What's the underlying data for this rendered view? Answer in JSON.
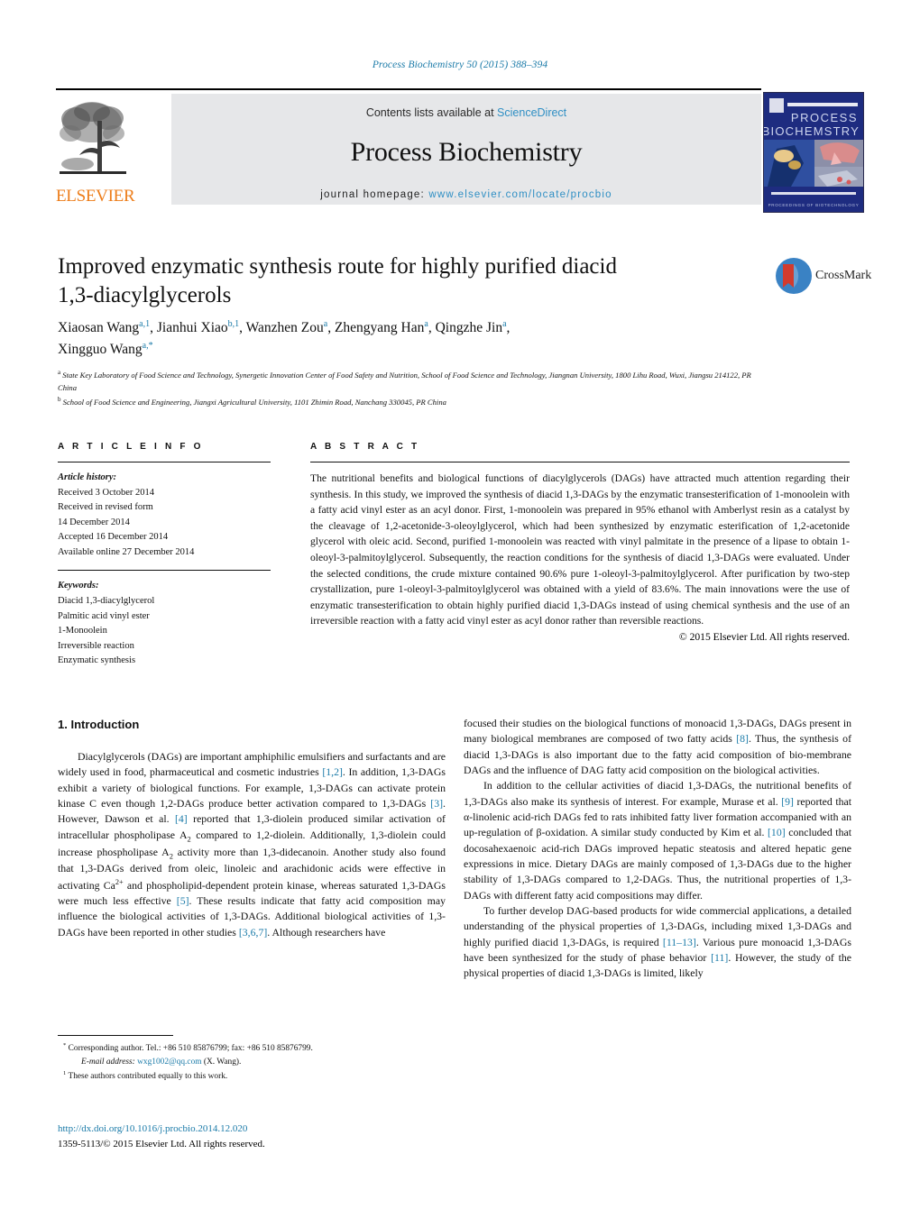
{
  "running_head": "Process Biochemistry 50 (2015) 388–394",
  "masthead": {
    "contents_text": "Contents lists available at",
    "sciencedirect": "ScienceDirect",
    "journal_name": "Process Biochemistry",
    "homepage_label": "journal homepage:",
    "homepage_url": "www.elsevier.com/locate/procbio",
    "publisher": "ELSEVIER",
    "cover_line1": "PROCESS",
    "cover_line2": "BIOCHEMISTRY",
    "accent_color": "#2f8fc4",
    "elsevier_orange": "#ed7d1a"
  },
  "crossmark": {
    "label": "CrossMark"
  },
  "article": {
    "title_line1": "Improved enzymatic synthesis route for highly purified diacid",
    "title_line2": "1,3-diacylglycerols",
    "authors": [
      {
        "name": "Xiaosan Wang",
        "marks": "a,1"
      },
      {
        "name": "Jianhui Xiao",
        "marks": "b,1"
      },
      {
        "name": "Wanzhen Zou",
        "marks": "a"
      },
      {
        "name": "Zhengyang Han",
        "marks": "a"
      },
      {
        "name": "Qingzhe Jin",
        "marks": "a"
      },
      {
        "name": "Xingguo Wang",
        "marks": "a,*"
      }
    ],
    "affiliations": [
      {
        "mark": "a",
        "text": "State Key Laboratory of Food Science and Technology, Synergetic Innovation Center of Food Safety and Nutrition, School of Food Science and Technology, Jiangnan University, 1800 Lihu Road, Wuxi, Jiangsu 214122, PR China"
      },
      {
        "mark": "b",
        "text": "School of Food Science and Engineering, Jiangxi Agricultural University, 1101 Zhimin Road, Nanchang 330045, PR China"
      }
    ]
  },
  "article_info": {
    "heading": "A R T I C L E   I N F O",
    "history_label": "Article history:",
    "history": [
      "Received 3 October 2014",
      "Received in revised form",
      "14 December 2014",
      "Accepted 16 December 2014",
      "Available online 27 December 2014"
    ],
    "keywords_label": "Keywords:",
    "keywords": [
      "Diacid 1,3-diacylglycerol",
      "Palmitic acid vinyl ester",
      "1-Monoolein",
      "Irreversible reaction",
      "Enzymatic synthesis"
    ]
  },
  "abstract": {
    "heading": "A B S T R A C T",
    "text": "The nutritional benefits and biological functions of diacylglycerols (DAGs) have attracted much attention regarding their synthesis. In this study, we improved the synthesis of diacid 1,3-DAGs by the enzymatic transesterification of 1-monoolein with a fatty acid vinyl ester as an acyl donor. First, 1-monoolein was prepared in 95% ethanol with Amberlyst resin as a catalyst by the cleavage of 1,2-acetonide-3-oleoylglycerol, which had been synthesized by enzymatic esterification of 1,2-acetonide glycerol with oleic acid. Second, purified 1-monoolein was reacted with vinyl palmitate in the presence of a lipase to obtain 1-oleoyl-3-palmitoylglycerol. Subsequently, the reaction conditions for the synthesis of diacid 1,3-DAGs were evaluated. Under the selected conditions, the crude mixture contained 90.6% pure 1-oleoyl-3-palmitoylglycerol. After purification by two-step crystallization, pure 1-oleoyl-3-palmitoylglycerol was obtained with a yield of 83.6%. The main innovations were the use of enzymatic transesterification to obtain highly purified diacid 1,3-DAGs instead of using chemical synthesis and the use of an irreversible reaction with a fatty acid vinyl ester as acyl donor rather than reversible reactions.",
    "copyright": "© 2015 Elsevier Ltd. All rights reserved."
  },
  "introduction": {
    "section_number": "1.",
    "section_title": "Introduction",
    "left_paragraph": "Diacylglycerols (DAGs) are important amphiphilic emulsifiers and surfactants and are widely used in food, pharmaceutical and cosmetic industries [1,2]. In addition, 1,3-DAGs exhibit a variety of biological functions. For example, 1,3-DAGs can activate protein kinase C even though 1,2-DAGs produce better activation compared to 1,3-DAGs [3]. However, Dawson et al. [4] reported that 1,3-diolein produced similar activation of intracellular phospholipase A2 compared to 1,2-diolein. Additionally, 1,3-diolein could increase phospholipase A2 activity more than 1,3-didecanoin. Another study also found that 1,3-DAGs derived from oleic, linoleic and arachidonic acids were effective in activating Ca2+ and phospholipid-dependent protein kinase, whereas saturated 1,3-DAGs were much less effective [5]. These results indicate that fatty acid composition may influence the biological activities of 1,3-DAGs. Additional biological activities of 1,3-DAGs have been reported in other studies [3,6,7]. Although researchers have",
    "right_paragraph_1": "focused their studies on the biological functions of monoacid 1,3-DAGs, DAGs present in many biological membranes are composed of two fatty acids [8]. Thus, the synthesis of diacid 1,3-DAGs is also important due to the fatty acid composition of bio-membrane DAGs and the influence of DAG fatty acid composition on the biological activities.",
    "right_paragraph_2": "In addition to the cellular activities of diacid 1,3-DAGs, the nutritional benefits of 1,3-DAGs also make its synthesis of interest. For example, Murase et al. [9] reported that α-linolenic acid-rich DAGs fed to rats inhibited fatty liver formation accompanied with an up-regulation of β-oxidation. A similar study conducted by Kim et al. [10] concluded that docosahexaenoic acid-rich DAGs improved hepatic steatosis and altered hepatic gene expressions in mice. Dietary DAGs are mainly composed of 1,3-DAGs due to the higher stability of 1,3-DAGs compared to 1,2-DAGs. Thus, the nutritional properties of 1,3-DAGs with different fatty acid compositions may differ.",
    "right_paragraph_3": "To further develop DAG-based products for wide commercial applications, a detailed understanding of the physical properties of 1,3-DAGs, including mixed 1,3-DAGs and highly purified diacid 1,3-DAGs, is required [11–13]. Various pure monoacid 1,3-DAGs have been synthesized for the study of phase behavior [11]. However, the study of the physical properties of diacid 1,3-DAGs is limited, likely"
  },
  "footnotes": {
    "corresponding": "Corresponding author. Tel.: +86 510 85876799; fax: +86 510 85876799.",
    "email_label": "E-mail address:",
    "email": "wxg1002@qq.com",
    "email_suffix": "(X. Wang).",
    "equal_contribution": "These authors contributed equally to this work."
  },
  "footer": {
    "doi": "http://dx.doi.org/10.1016/j.procbio.2014.12.020",
    "issn_line": "1359-5113/© 2015 Elsevier Ltd. All rights reserved."
  }
}
